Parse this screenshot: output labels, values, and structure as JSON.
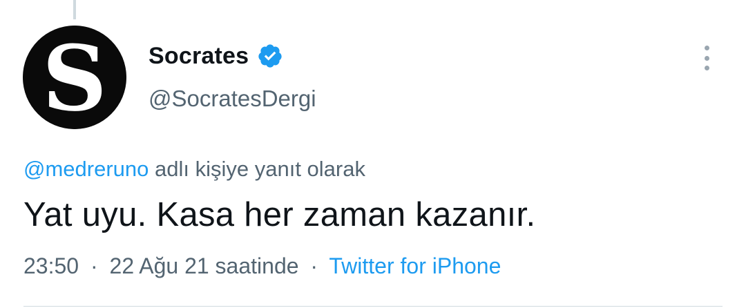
{
  "author": {
    "display_name": "Socrates",
    "handle": "@SocratesDergi",
    "verified": true,
    "avatar_letter": "S",
    "avatar_icon": "socrates-logo",
    "verified_icon": "verified-badge-icon"
  },
  "reply": {
    "mention": "@medreruno",
    "context_text": "adlı kişiye yanıt olarak"
  },
  "tweet": {
    "text": "Yat uyu. Kasa her zaman kazanır."
  },
  "meta": {
    "time": "23:50",
    "separator": "·",
    "date": "22 Ağu 21 saatinde",
    "source": "Twitter for iPhone"
  },
  "more_icon": "more-vertical-icon",
  "colors": {
    "accent": "#1d9bf0",
    "text_primary": "#0f1419",
    "text_secondary": "#536471",
    "divider": "#cfd9de"
  }
}
